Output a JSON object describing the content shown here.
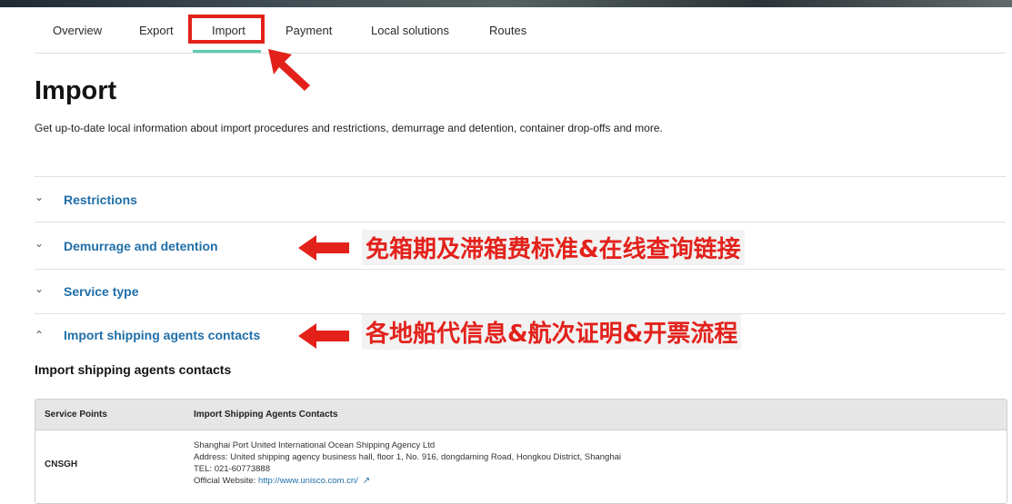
{
  "tabs": [
    {
      "label": "Overview"
    },
    {
      "label": "Export"
    },
    {
      "label": "Import"
    },
    {
      "label": "Payment"
    },
    {
      "label": "Local solutions"
    },
    {
      "label": "Routes"
    }
  ],
  "active_tab": "Import",
  "page": {
    "title": "Import",
    "intro": "Get up-to-date local information about import procedures and restrictions, demurrage and detention, container drop-offs and more."
  },
  "accordion": [
    {
      "label": "Restrictions",
      "state": "collapsed",
      "chevron": "chevron-down-icon"
    },
    {
      "label": "Demurrage and detention",
      "state": "collapsed",
      "chevron": "chevron-down-icon"
    },
    {
      "label": "Service type",
      "state": "collapsed",
      "chevron": "chevron-down-icon"
    },
    {
      "label": "Import shipping agents contacts",
      "state": "expanded",
      "chevron": "chevron-up-icon"
    }
  ],
  "annotations": [
    {
      "text": "免箱期及滞箱费标准&在线查询链接"
    },
    {
      "text": "各地船代信息&航次证明&开票流程"
    }
  ],
  "section": {
    "heading": "Import shipping agents contacts",
    "table": {
      "headers": [
        "Service Points",
        "Import Shipping Agents Contacts"
      ],
      "rows": [
        {
          "code": "CNSGH",
          "company": "Shanghai Port United International Ocean Shipping Agency Ltd",
          "address": "Address: United shipping agency business hall, floor 1, No. 916, dongdaming Road, Hongkou District, Shanghai",
          "tel": "TEL: 021-60773888",
          "website_label": "Official Website: ",
          "website_url": "http://www.unisco.com.cn/"
        }
      ]
    }
  },
  "colors": {
    "accent_teal": "#5dcbb2",
    "link_blue": "#1f6ea8",
    "annotation_red": "#e3211b"
  }
}
